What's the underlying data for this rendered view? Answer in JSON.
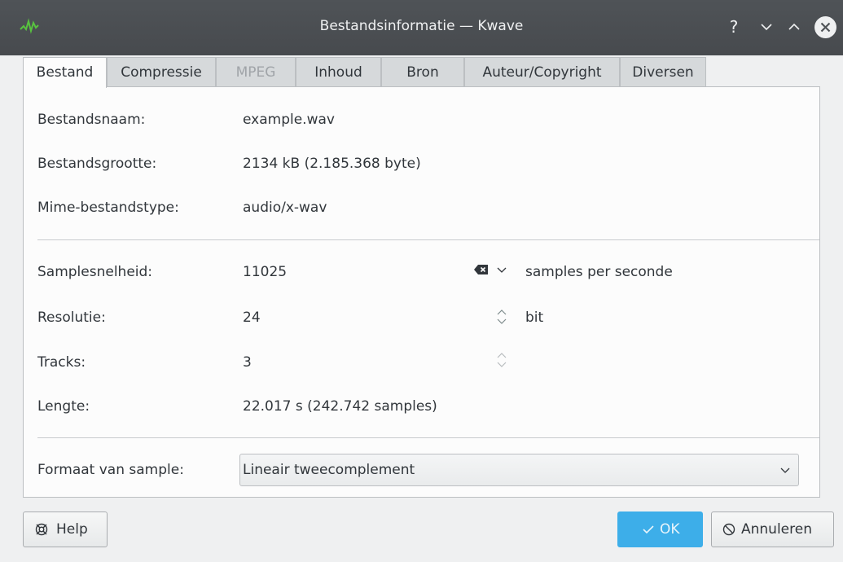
{
  "window": {
    "title": "Bestandsinformatie — Kwave",
    "help_glyph": "?"
  },
  "tabs": [
    {
      "label": "Bestand",
      "state": "active"
    },
    {
      "label": "Compressie",
      "state": "normal"
    },
    {
      "label": "MPEG",
      "state": "disabled"
    },
    {
      "label": "Inhoud",
      "state": "normal"
    },
    {
      "label": "Bron",
      "state": "normal"
    },
    {
      "label": "Auteur/Copyright",
      "state": "normal"
    },
    {
      "label": "Diversen",
      "state": "normal"
    }
  ],
  "file": {
    "name_label": "Bestandsnaam:",
    "name_value": "example.wav",
    "size_label": "Bestandsgrootte:",
    "size_value": "2134 kB (2.185.368 byte)",
    "mime_label": "Mime-bestandstype:",
    "mime_value": "audio/x-wav"
  },
  "audio": {
    "rate_label": "Samplesnelheid:",
    "rate_value": "11025",
    "rate_unit": "samples per seconde",
    "res_label": "Resolutie:",
    "res_value": "24",
    "res_unit": "bit",
    "tracks_label": "Tracks:",
    "tracks_value": "3",
    "length_label": "Lengte:",
    "length_value": "22.017 s (242.742 samples)"
  },
  "format": {
    "label": "Formaat van sample:",
    "selected": "Lineair tweecomplement"
  },
  "buttons": {
    "help": "Help",
    "ok": "OK",
    "cancel": "Annuleren"
  },
  "colors": {
    "titlebar": "#4f5357",
    "accent": "#3daee9",
    "panel": "#fcfcfc",
    "window": "#eff0f1"
  },
  "icons": {
    "app": "kwave-waveform-icon",
    "help": "lifebuoy-icon",
    "ok": "check-icon",
    "cancel": "cancel-circle-icon"
  }
}
